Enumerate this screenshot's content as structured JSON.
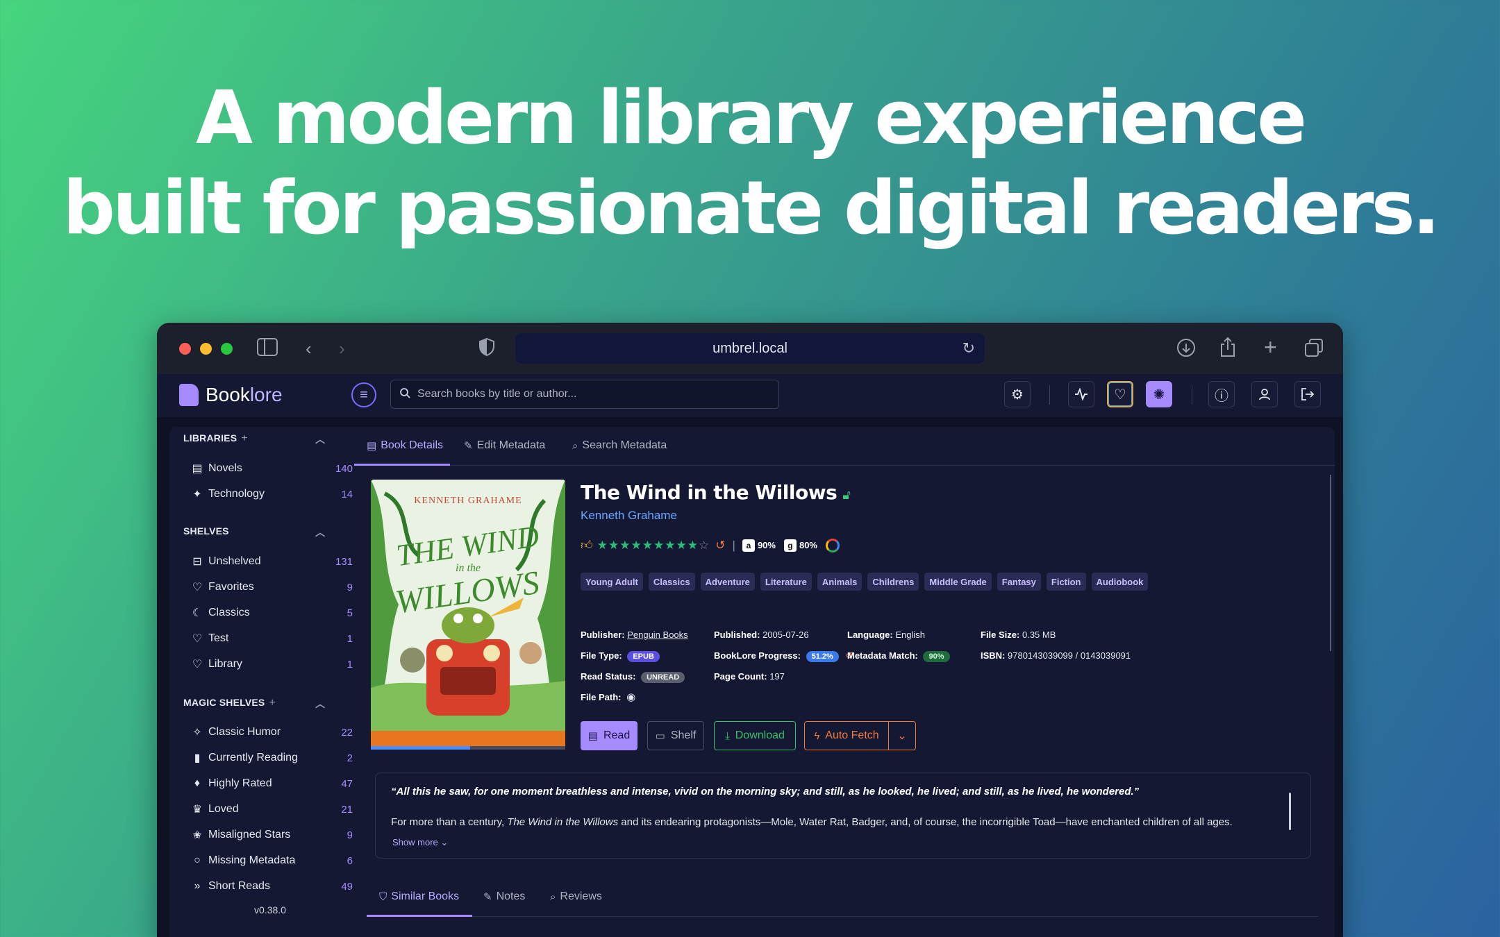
{
  "headline": {
    "line1": "A modern library experience",
    "line2": "built for passionate digital readers."
  },
  "browser": {
    "url": "umbrel.local"
  },
  "app": {
    "logo_book": "Book",
    "logo_lore": "lore",
    "search_placeholder": "Search books by title or author..."
  },
  "sidebar": {
    "libraries_title": "LIBRARIES",
    "libraries": [
      {
        "label": "Novels",
        "count": "140"
      },
      {
        "label": "Technology",
        "count": "14"
      }
    ],
    "shelves_title": "SHELVES",
    "shelves": [
      {
        "label": "Unshelved",
        "count": "131"
      },
      {
        "label": "Favorites",
        "count": "9"
      },
      {
        "label": "Classics",
        "count": "5"
      },
      {
        "label": "Test",
        "count": "1"
      },
      {
        "label": "Library",
        "count": "1"
      }
    ],
    "magic_title": "MAGIC SHELVES",
    "magic": [
      {
        "label": "Classic Humor",
        "count": "22"
      },
      {
        "label": "Currently Reading",
        "count": "2"
      },
      {
        "label": "Highly Rated",
        "count": "47"
      },
      {
        "label": "Loved",
        "count": "21"
      },
      {
        "label": "Misaligned Stars",
        "count": "9"
      },
      {
        "label": "Missing Metadata",
        "count": "6"
      },
      {
        "label": "Short Reads",
        "count": "49"
      }
    ],
    "version": "v0.38.0"
  },
  "tabs": {
    "details": "Book Details",
    "edit": "Edit Metadata",
    "search": "Search Metadata"
  },
  "book": {
    "cover_author": "KENNETH GRAHAME",
    "cover_title1": "THE WIND",
    "cover_title2": "in the",
    "cover_title3": "WILLOWS",
    "title": "The Wind in the Willows",
    "author": "Kenneth Grahame",
    "rating_stars": 9,
    "rating_max": 10,
    "amazon_score": "90%",
    "goodreads_score": "80%",
    "reading_progress": 0.512,
    "tags": [
      "Young Adult",
      "Classics",
      "Adventure",
      "Literature",
      "Animals",
      "Childrens",
      "Middle Grade",
      "Fantasy",
      "Fiction",
      "Audiobook"
    ],
    "publisher_label": "Publisher:",
    "publisher": "Penguin Books",
    "published_label": "Published:",
    "published": "2005-07-26",
    "language_label": "Language:",
    "language": "English",
    "filesize_label": "File Size:",
    "filesize": "0.35 MB",
    "filetype_label": "File Type:",
    "filetype": "EPUB",
    "progress_label": "BookLore Progress:",
    "progress": "51.2%",
    "match_label": "Metadata Match:",
    "match": "90%",
    "isbn_label": "ISBN:",
    "isbn": "9780143039099 / 0143039091",
    "status_label": "Read Status:",
    "status": "UNREAD",
    "pages_label": "Page Count:",
    "pages": "197",
    "filepath_label": "File Path:"
  },
  "actions": {
    "read": "Read",
    "shelf": "Shelf",
    "download": "Download",
    "autofetch": "Auto Fetch"
  },
  "description": {
    "quote": "“All this he saw, for one moment breathless and intense, vivid on the morning sky; and still, as he looked, he lived; and still, as he lived, he wondered.”",
    "body_pre": "For more than a century, ",
    "body_italic": "The Wind in the Willows",
    "body_post": " and its endearing protagonists—Mole, Water Rat, Badger, and, of course, the incorrigible Toad—have enchanted children of all ages.",
    "show_more": "Show more"
  },
  "bottom_tabs": {
    "similar": "Similar Books",
    "notes": "Notes",
    "reviews": "Reviews"
  },
  "colors": {
    "accent": "#a58bff",
    "link": "#6aa8ff",
    "download": "#39c06a",
    "autofetch": "#f07a3a"
  }
}
